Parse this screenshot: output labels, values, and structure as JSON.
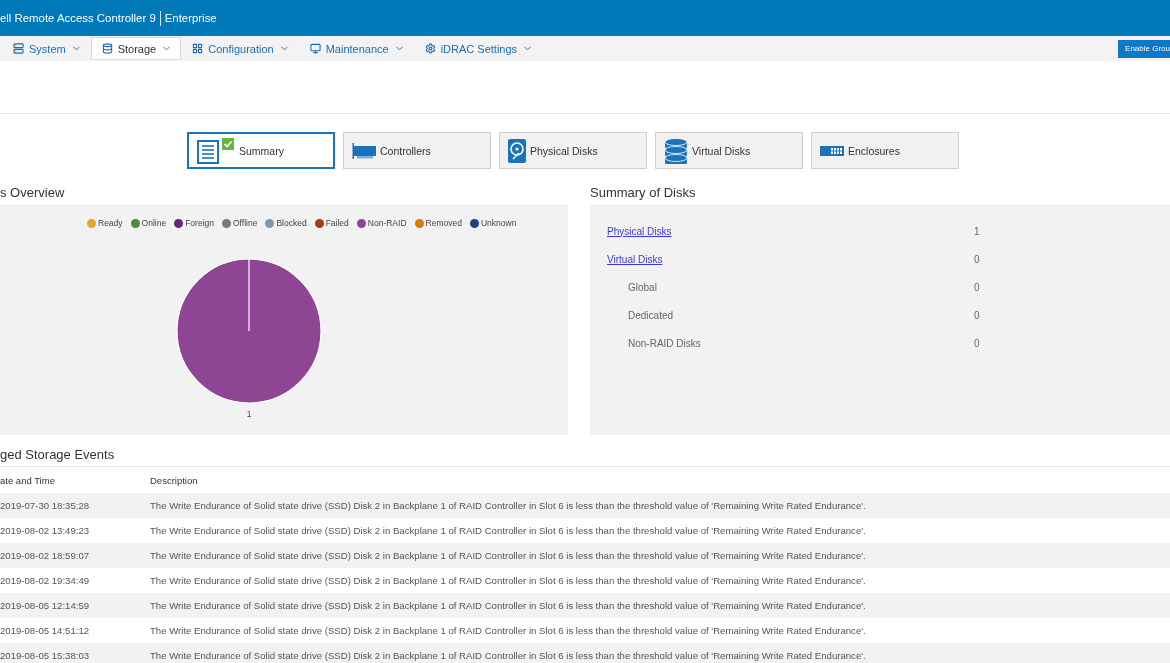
{
  "header": {
    "title": "ell Remote Access Controller 9",
    "edition": "Enterprise"
  },
  "nav": {
    "items": [
      {
        "label": "System",
        "selected": false
      },
      {
        "label": "Storage",
        "selected": true
      },
      {
        "label": "Configuration",
        "selected": false
      },
      {
        "label": "Maintenance",
        "selected": false
      },
      {
        "label": "iDRAC Settings",
        "selected": false
      }
    ],
    "action": "Enable Grou"
  },
  "storage_tabs": [
    {
      "label": "Summary",
      "selected": true
    },
    {
      "label": "Controllers",
      "selected": false
    },
    {
      "label": "Physical Disks",
      "selected": false
    },
    {
      "label": "Virtual Disks",
      "selected": false
    },
    {
      "label": "Enclosures",
      "selected": false
    }
  ],
  "overview": {
    "title": "s Overview",
    "legend": [
      {
        "label": "Ready",
        "color": "#e3a82b"
      },
      {
        "label": "Online",
        "color": "#4b8b3b"
      },
      {
        "label": "Foreign",
        "color": "#5e2b78"
      },
      {
        "label": "Offline",
        "color": "#7f7770"
      },
      {
        "label": "Blocked",
        "color": "#7c98b8"
      },
      {
        "label": "Failed",
        "color": "#a43b20"
      },
      {
        "label": "Non-RAID",
        "color": "#8e4594"
      },
      {
        "label": "Removed",
        "color": "#d97a0a"
      },
      {
        "label": "Unknown",
        "color": "#213f87"
      }
    ],
    "chart_data": {
      "type": "pie",
      "values": [
        0,
        0,
        0,
        0,
        0,
        0,
        1,
        0,
        0
      ],
      "data_labels": true
    }
  },
  "disk_summary": {
    "title": "Summary of Disks",
    "rows": [
      {
        "kind": "link",
        "label": "Physical Disks",
        "value": "1"
      },
      {
        "kind": "link",
        "label": "Virtual Disks",
        "value": "0"
      },
      {
        "kind": "sub",
        "label": "Global",
        "value": "0"
      },
      {
        "kind": "sub",
        "label": "Dedicated",
        "value": "0"
      },
      {
        "kind": "sub",
        "label": "Non-RAID Disks",
        "value": "0"
      }
    ]
  },
  "events": {
    "title": "ged Storage Events",
    "columns": [
      "ate and Time",
      "Description"
    ],
    "rows": [
      {
        "date": "2019-07-30 18:35:28",
        "description": "The Write Endurance of Solid state drive (SSD) Disk 2 in Backplane 1 of RAID Controller in Slot 6 is less than the threshold value of 'Remaining Write Rated Endurance'."
      },
      {
        "date": "2019-08-02 13:49:23",
        "description": "The Write Endurance of Solid state drive (SSD) Disk 2 in Backplane 1 of RAID Controller in Slot 6 is less than the threshold value of 'Remaining Write Rated Endurance'."
      },
      {
        "date": "2019-08-02 18:59:07",
        "description": "The Write Endurance of Solid state drive (SSD) Disk 2 in Backplane 1 of RAID Controller in Slot 6 is less than the threshold value of 'Remaining Write Rated Endurance'."
      },
      {
        "date": "2019-08-02 19:34:49",
        "description": "The Write Endurance of Solid state drive (SSD) Disk 2 in Backplane 1 of RAID Controller in Slot 6 is less than the threshold value of 'Remaining Write Rated Endurance'."
      },
      {
        "date": "2019-08-05 12:14:59",
        "description": "The Write Endurance of Solid state drive (SSD) Disk 2 in Backplane 1 of RAID Controller in Slot 6 is less than the threshold value of 'Remaining Write Rated Endurance'."
      },
      {
        "date": "2019-08-05 14:51:12",
        "description": "The Write Endurance of Solid state drive (SSD) Disk 2 in Backplane 1 of RAID Controller in Slot 6 is less than the threshold value of 'Remaining Write Rated Endurance'."
      },
      {
        "date": "2019-08-05 15:38:03",
        "description": "The Write Endurance of Solid state drive (SSD) Disk 2 in Backplane 1 of RAID Controller in Slot 6 is less than the threshold value of 'Remaining Write Rated Endurance'."
      }
    ]
  }
}
